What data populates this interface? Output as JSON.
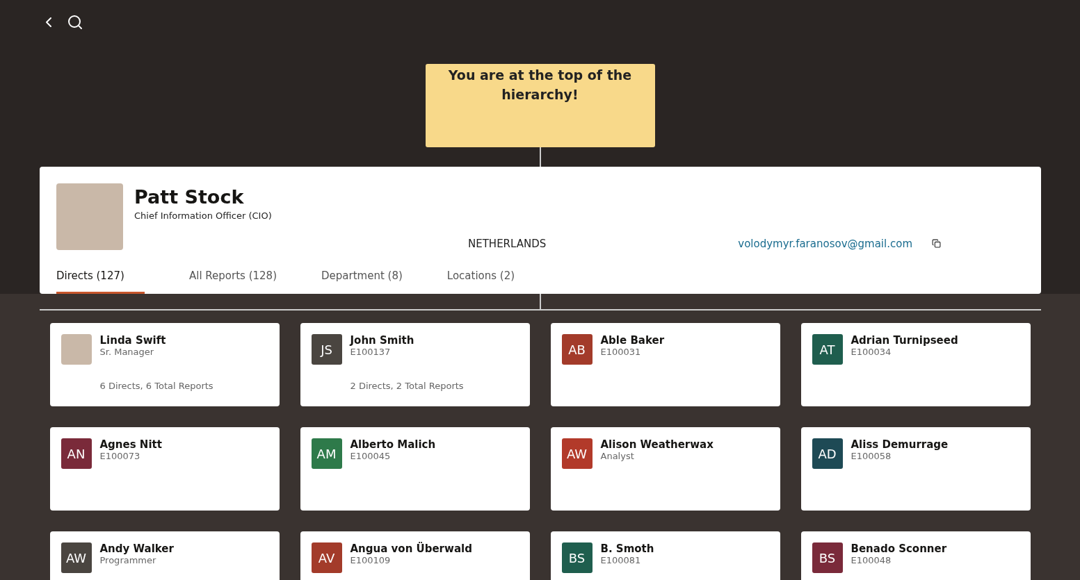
{
  "banner": {
    "text": "You are at the top of the hierarchy!"
  },
  "profile": {
    "name": "Patt Stock",
    "title": "Chief Information Officer (CIO)",
    "country": "NETHERLANDS",
    "email": "volodymyr.faranosov@gmail.com"
  },
  "tabs": [
    {
      "label": "Directs (127)",
      "selected": true
    },
    {
      "label": "All Reports (128)",
      "selected": false
    },
    {
      "label": "Department (8)",
      "selected": false
    },
    {
      "label": "Locations (2)",
      "selected": false
    }
  ],
  "directs": [
    {
      "name": "Linda Swift",
      "subtitle": "Sr. Manager",
      "summary": "6 Directs, 6 Total Reports",
      "avatar": {
        "kind": "photo"
      }
    },
    {
      "name": "John Smith",
      "subtitle": "E100137",
      "summary": "2 Directs, 2 Total Reports",
      "avatar": {
        "kind": "initials",
        "initials": "JS",
        "color": "#4a4540"
      }
    },
    {
      "name": "Able Baker",
      "subtitle": "E100031",
      "avatar": {
        "kind": "initials",
        "initials": "AB",
        "color": "#a33b2a"
      }
    },
    {
      "name": "Adrian Turnipseed",
      "subtitle": "E100034",
      "avatar": {
        "kind": "initials",
        "initials": "AT",
        "color": "#1f5e4e"
      }
    },
    {
      "name": "Agnes Nitt",
      "subtitle": "E100073",
      "avatar": {
        "kind": "initials",
        "initials": "AN",
        "color": "#7a2a3a"
      }
    },
    {
      "name": "Alberto Malich",
      "subtitle": "E100045",
      "avatar": {
        "kind": "initials",
        "initials": "AM",
        "color": "#2e7a4a"
      }
    },
    {
      "name": "Alison Weatherwax",
      "subtitle": "Analyst",
      "avatar": {
        "kind": "initials",
        "initials": "AW",
        "color": "#b23a2a"
      }
    },
    {
      "name": "Aliss Demurrage",
      "subtitle": "E100058",
      "avatar": {
        "kind": "initials",
        "initials": "AD",
        "color": "#1e4a55"
      }
    },
    {
      "name": "Andy Walker",
      "subtitle": "Programmer",
      "avatar": {
        "kind": "initials",
        "initials": "AW",
        "color": "#4a4540"
      }
    },
    {
      "name": "Angua von Überwald",
      "subtitle": "E100109",
      "avatar": {
        "kind": "initials",
        "initials": "AV",
        "color": "#a33b2a"
      }
    },
    {
      "name": "B. Smoth",
      "subtitle": "E100081",
      "avatar": {
        "kind": "initials",
        "initials": "BS",
        "color": "#1f5e4e"
      }
    },
    {
      "name": "Benado Sconner",
      "subtitle": "E100048",
      "avatar": {
        "kind": "initials",
        "initials": "BS",
        "color": "#7a2a3a"
      }
    }
  ]
}
